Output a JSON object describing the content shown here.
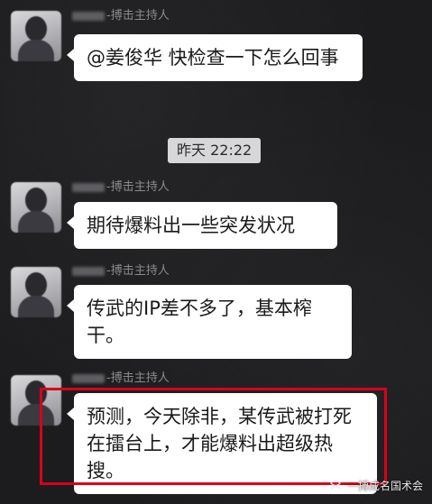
{
  "messages": [
    {
      "sender": "-搏击主持人",
      "text": "@姜俊华 快检查一下怎么回事"
    },
    {
      "sender": "-搏击主持人",
      "text": "期待爆料出一些突发状况"
    },
    {
      "sender": "-搏击主持人",
      "text": "传武的IP差不多了，基本榨干。"
    },
    {
      "sender": "-搏击主持人",
      "text": "预测，今天除非，某传武被打死在擂台上，才能爆料出超级热搜。"
    }
  ],
  "timestamp": "昨天 22:22",
  "watermark": "一搏成名国术会",
  "colors": {
    "background": "#1b1b1d",
    "bubble": "#ffffff",
    "highlight": "#d9001b",
    "timestamp_bg": "#d7d7d9"
  },
  "icons": [
    "avatar",
    "wechat-channel-icon"
  ]
}
